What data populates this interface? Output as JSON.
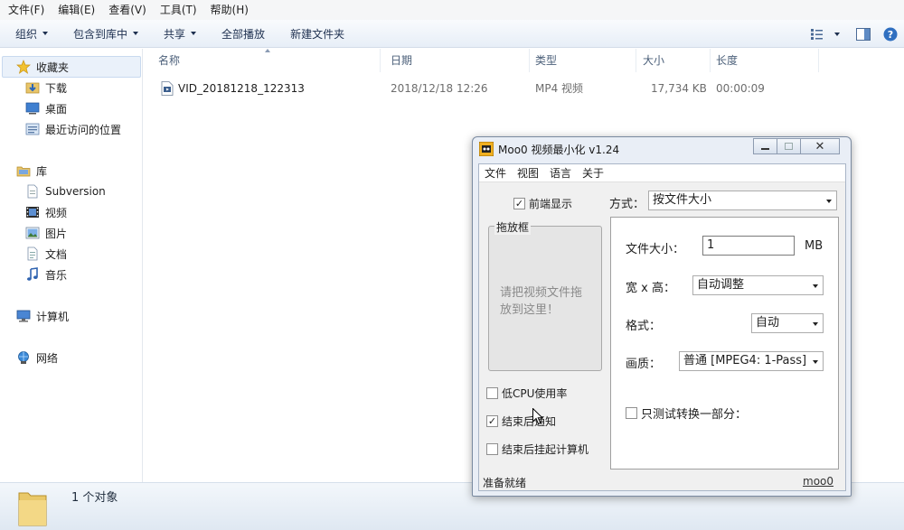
{
  "menubar": [
    "文件(F)",
    "编辑(E)",
    "查看(V)",
    "工具(T)",
    "帮助(H)"
  ],
  "toolbar": {
    "organize": "组织",
    "include_library": "包含到库中",
    "share": "共享",
    "play_all": "全部播放",
    "new_folder": "新建文件夹"
  },
  "nav": {
    "favorites": "收藏夹",
    "downloads": "下载",
    "desktop": "桌面",
    "recent": "最近访问的位置",
    "libraries": "库",
    "subversion": "Subversion",
    "videos": "视频",
    "pictures": "图片",
    "documents": "文档",
    "music": "音乐",
    "computer": "计算机",
    "network": "网络"
  },
  "columns": {
    "name": "名称",
    "date": "日期",
    "type": "类型",
    "size": "大小",
    "length": "长度"
  },
  "files": [
    {
      "name": "VID_20181218_122313",
      "date": "2018/12/18 12:26",
      "type": "MP4 视频",
      "size": "17,734 KB",
      "length": "00:00:09"
    }
  ],
  "details": {
    "count": "1 个对象"
  },
  "moo0": {
    "title": "Moo0 视频最小化 v1.24",
    "menu": [
      "文件",
      "视图",
      "语言",
      "关于"
    ],
    "always_on_top": "前端显示",
    "mode_label": "方式：",
    "mode_value": "按文件大小",
    "drop_legend": "拖放框",
    "drop_hint": "请把视频文件拖放到这里！",
    "filesize_label": "文件大小：",
    "filesize_value": "1",
    "filesize_unit": "MB",
    "wh_label": "宽 x 高：",
    "wh_value": "自动调整",
    "format_label": "格式：",
    "format_value": "自动",
    "quality_label": "画质：",
    "quality_value": "普通  [MPEG4: 1-Pass]",
    "test_part": "只测试转换一部分：",
    "low_cpu": "低CPU使用率",
    "notify_done": "结束后通知",
    "sleep_done": "结束后挂起计算机",
    "status": "准备就绪",
    "link": "moo0",
    "checks": {
      "always_on_top": true,
      "test_part": false,
      "low_cpu": false,
      "notify_done": true,
      "sleep_done": false
    }
  }
}
